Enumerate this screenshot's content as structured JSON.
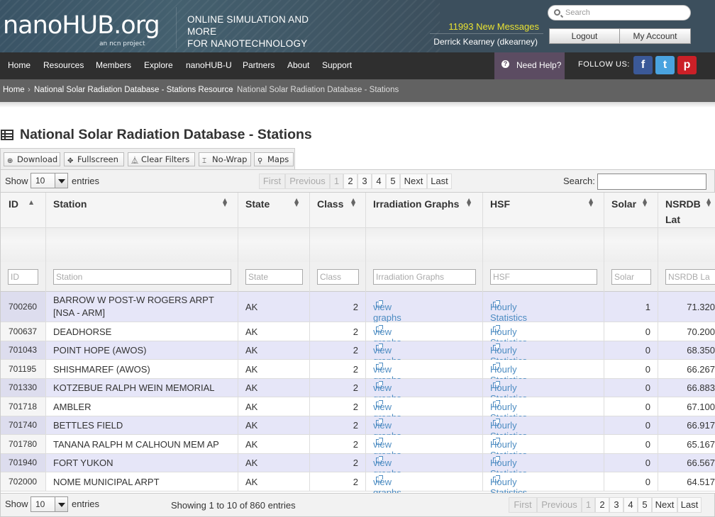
{
  "header": {
    "logo": "nanoHUB.org",
    "logo_sub": "an ncn project",
    "tagline_line1": "ONLINE SIMULATION AND MORE",
    "tagline_line2": "FOR NANOTECHNOLOGY",
    "messages": "11993 New Messages",
    "user": "Derrick Kearney (dkearney)",
    "search_placeholder": "Search",
    "logout": "Logout",
    "my_account": "My Account"
  },
  "nav": {
    "items": [
      "Home",
      "Resources",
      "Members",
      "Explore",
      "nanoHUB-U",
      "Partners",
      "About",
      "Support"
    ],
    "help": "Need Help?",
    "follow": "FOLLOW US:",
    "social": [
      {
        "icon": "facebook-icon",
        "glyph": "f",
        "color": "#3b5998"
      },
      {
        "icon": "twitter-icon",
        "glyph": "t",
        "color": "#4aa3df"
      },
      {
        "icon": "pinterest-icon",
        "glyph": "p",
        "color": "#cb2027"
      }
    ]
  },
  "breadcrumb": {
    "home": "Home",
    "sep": "›",
    "resource": "National Solar Radiation Database - Stations Resource",
    "current": "National Solar Radiation Database - Stations"
  },
  "page": {
    "title": "National Solar Radiation Database - Stations"
  },
  "toolbar": {
    "download": "Download",
    "fullscreen": "Fullscreen",
    "clear_filters": "Clear Filters",
    "nowrap": "No-Wrap",
    "maps": "Maps"
  },
  "table_controls": {
    "show": "Show",
    "entries": "entries",
    "page_length": "10",
    "search_label": "Search:",
    "info": "Showing 1 to 10 of 860 entries",
    "pager": [
      "First",
      "Previous",
      "1",
      "2",
      "3",
      "4",
      "5",
      "Next",
      "Last"
    ]
  },
  "table": {
    "columns": [
      "ID",
      "Station",
      "State",
      "Class",
      "Irradiation Graphs",
      "HSF",
      "Solar",
      "NSRDB",
      "Lat"
    ],
    "filters": [
      "ID",
      "Station",
      "State",
      "Class",
      "Irradiation Graphs",
      "HSF",
      "Solar",
      "NSRDB  La"
    ],
    "link_graphs": "view graphs",
    "link_hsf": "Hourly Statistics File",
    "rows": [
      {
        "id": "700260",
        "station1": "BARROW W POST-W ROGERS ARPT",
        "station2": "[NSA - ARM]",
        "state": "AK",
        "class": "2",
        "solar": "1",
        "lat": "71.320"
      },
      {
        "id": "700637",
        "station1": "DEADHORSE",
        "station2": "",
        "state": "AK",
        "class": "2",
        "solar": "0",
        "lat": "70.200"
      },
      {
        "id": "701043",
        "station1": "POINT HOPE (AWOS)",
        "station2": "",
        "state": "AK",
        "class": "2",
        "solar": "0",
        "lat": "68.350"
      },
      {
        "id": "701195",
        "station1": "SHISHMAREF (AWOS)",
        "station2": "",
        "state": "AK",
        "class": "2",
        "solar": "0",
        "lat": "66.267"
      },
      {
        "id": "701330",
        "station1": "KOTZEBUE RALPH WEIN MEMORIAL",
        "station2": "",
        "state": "AK",
        "class": "2",
        "solar": "0",
        "lat": "66.883"
      },
      {
        "id": "701718",
        "station1": "AMBLER",
        "station2": "",
        "state": "AK",
        "class": "2",
        "solar": "0",
        "lat": "67.100"
      },
      {
        "id": "701740",
        "station1": "BETTLES FIELD",
        "station2": "",
        "state": "AK",
        "class": "2",
        "solar": "0",
        "lat": "66.917"
      },
      {
        "id": "701780",
        "station1": "TANANA RALPH M CALHOUN MEM AP",
        "station2": "",
        "state": "AK",
        "class": "2",
        "solar": "0",
        "lat": "65.167"
      },
      {
        "id": "701940",
        "station1": "FORT YUKON",
        "station2": "",
        "state": "AK",
        "class": "2",
        "solar": "0",
        "lat": "66.567"
      },
      {
        "id": "702000",
        "station1": "NOME MUNICIPAL ARPT",
        "station2": "",
        "state": "AK",
        "class": "2",
        "solar": "0",
        "lat": "64.517"
      }
    ]
  }
}
